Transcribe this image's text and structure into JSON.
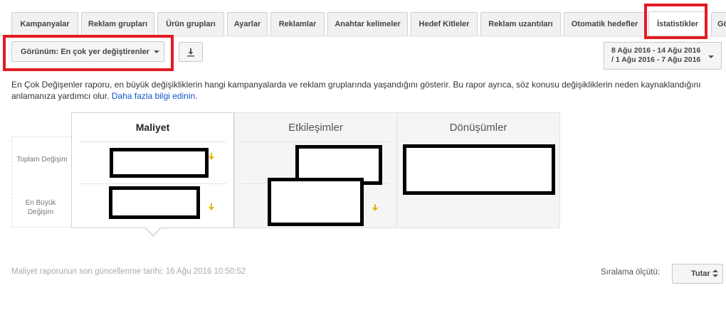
{
  "tabs": [
    {
      "label": "Kampanyalar"
    },
    {
      "label": "Reklam grupları"
    },
    {
      "label": "Ürün grupları"
    },
    {
      "label": "Ayarlar"
    },
    {
      "label": "Reklamlar"
    },
    {
      "label": "Anahtar kelimeler"
    },
    {
      "label": "Hedef Kitleler"
    },
    {
      "label": "Reklam uzantıları"
    },
    {
      "label": "Otomatik hedefler"
    },
    {
      "label": "İstatistikler"
    },
    {
      "label": "Gö"
    }
  ],
  "active_tab": "İstatistikler",
  "toolbar": {
    "view_label": "Görünüm: En çok yer değiştirenler",
    "download_icon": "download-icon",
    "date_line1": "8 Ağu 2016 - 14 Ağu 2016",
    "date_line2": "/ 1 Ağu 2016 - 7 Ağu 2016"
  },
  "description": {
    "text": "En Çok Değişenler raporu, en büyük değişikliklerin hangi kampanyalarda ve reklam gruplarında yaşandığını gösterir. Bu rapor ayrıca, söz konusu değişikliklerin neden kaynaklandığını anlamanıza yardımcı olur.",
    "link": "Daha fazla bilgi edinin",
    "end": "."
  },
  "report": {
    "row_labels": [
      "Toplam Değişim",
      "En Büyük Değişim"
    ],
    "columns": [
      {
        "title": "Maliyet"
      },
      {
        "title": "Etkileşimler"
      },
      {
        "title": "Dönüşümler"
      }
    ]
  },
  "footer": {
    "update_note": "Maliyet raporunun son güncellenme tarihi: 16 Ağu 2016 10:50:52",
    "sort_label": "Sıralama ölçütü:",
    "sort_value": "Tutar"
  },
  "colors": {
    "highlight": "#e31b23",
    "link": "#1155cc",
    "trend_down": "#e8b400"
  }
}
